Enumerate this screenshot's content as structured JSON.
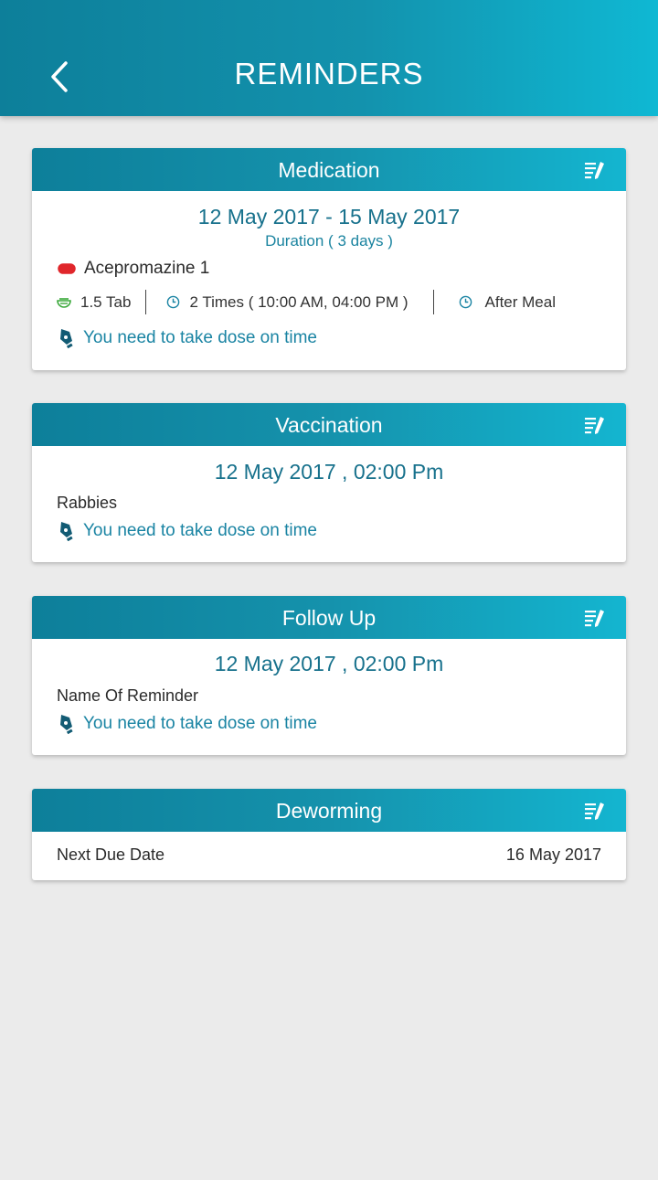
{
  "header": {
    "title": "REMINDERS"
  },
  "medication": {
    "title": "Medication",
    "date_range": "12 May 2017 - 15 May 2017",
    "duration": "Duration ( 3 days )",
    "drug": "Acepromazine 1",
    "dose": "1.5 Tab",
    "frequency": "2 Times ( 10:00 AM, 04:00 PM )",
    "meal": "After Meal",
    "note": "You need to take dose on time"
  },
  "vaccination": {
    "title": "Vaccination",
    "datetime": "12 May 2017 , 02:00 Pm",
    "name": "Rabbies",
    "note": "You need to take dose on time"
  },
  "followup": {
    "title": "Follow Up",
    "datetime": "12 May 2017 , 02:00 Pm",
    "name": "Name Of Reminder",
    "note": "You need to take dose on time"
  },
  "deworming": {
    "title": "Deworming",
    "label": "Next Due Date",
    "date": "16 May 2017"
  },
  "colors": {
    "header_gradient_start": "#0d7f9a",
    "header_gradient_end": "#0fb8d3",
    "accent_text": "#17718c",
    "pill_red": "#e0262b",
    "dose_green": "#3aa83a"
  },
  "icons": [
    "chevron-left-icon",
    "edit-list-icon",
    "pill-icon",
    "tablet-icon",
    "clock-icon",
    "pen-nib-icon"
  ]
}
